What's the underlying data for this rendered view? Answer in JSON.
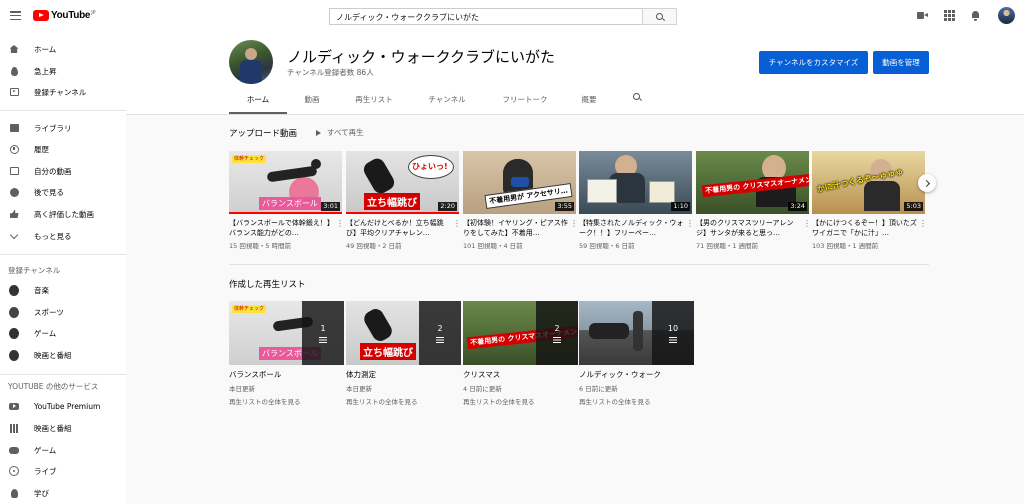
{
  "header": {
    "logo_text": "YouTube",
    "logo_region": "JP",
    "search_value": "ノルディック・ウォーククラブにいがた"
  },
  "sidebar": {
    "main": [
      {
        "label": "ホーム",
        "icon": "home-icon"
      },
      {
        "label": "急上昇",
        "icon": "fire-icon"
      },
      {
        "label": "登録チャンネル",
        "icon": "subscriptions-icon"
      }
    ],
    "library": [
      {
        "label": "ライブラリ",
        "icon": "library-icon"
      },
      {
        "label": "履歴",
        "icon": "history-icon"
      },
      {
        "label": "自分の動画",
        "icon": "your-videos-icon"
      },
      {
        "label": "後で見る",
        "icon": "watch-later-icon"
      },
      {
        "label": "高く評価した動画",
        "icon": "like-icon"
      },
      {
        "label": "もっと見る",
        "icon": "chevron-down-icon"
      }
    ],
    "subs_heading": "登録チャンネル",
    "subs": [
      {
        "label": "音楽",
        "icon": "music-icon"
      },
      {
        "label": "スポーツ",
        "icon": "sports-icon"
      },
      {
        "label": "ゲーム",
        "icon": "gaming-icon"
      },
      {
        "label": "映画と番組",
        "icon": "movies-icon"
      }
    ],
    "more_heading": "YOUTUBE の他のサービス",
    "more": [
      {
        "label": "YouTube Premium",
        "icon": "youtube-premium-icon"
      },
      {
        "label": "映画と番組",
        "icon": "film-icon"
      },
      {
        "label": "ゲーム",
        "icon": "gaming-icon"
      },
      {
        "label": "ライブ",
        "icon": "live-icon"
      },
      {
        "label": "学び",
        "icon": "learning-icon"
      }
    ]
  },
  "channel": {
    "name": "ノルディック・ウォーククラブにいがた",
    "subscribers": "チャンネル登録者数 86人",
    "customize_label": "チャンネルをカスタマイズ",
    "manage_label": "動画を管理"
  },
  "tabs": [
    "ホーム",
    "動画",
    "再生リスト",
    "チャンネル",
    "フリートーク",
    "概要"
  ],
  "uploads": {
    "title": "アップロード動画",
    "play_all": "すべて再生",
    "videos": [
      {
        "title": "【バランスボールで体幹鍛え！】バランス能力がどの…",
        "meta": "15 回視聴・5 時間前",
        "duration": "3:01",
        "caption": "バランスボール",
        "badge": "体幹チェック",
        "progress": 1.0
      },
      {
        "title": "【どんだけとべるか！立ち幅跳び】平均クリアチャレン…",
        "meta": "49 回視聴・2 日前",
        "duration": "2:20",
        "caption": "立ち幅跳び",
        "bubble": "ひょいっ!",
        "progress": 1.0
      },
      {
        "title": "【初体験！イヤリング・ピアス作りをしてみた】不着用…",
        "meta": "101 回視聴・4 日前",
        "duration": "3:55",
        "caption": "不着用男が アクセサリ…",
        "progress": 0.0
      },
      {
        "title": "【特集されたノルディック・ウォーク！！】フリーペー…",
        "meta": "59 回視聴・6 日前",
        "duration": "1:10",
        "progress": 0.0
      },
      {
        "title": "【男のクリスマスツリーアレンジ】サンタが来ると思っ…",
        "meta": "71 回視聴・1 週間前",
        "duration": "3:24",
        "caption": "不着用男の クリスマスオーナメント",
        "progress": 0.0
      },
      {
        "title": "【かにけつくるぞー！】頂いたズワイガニで「かに汁」…",
        "meta": "103 回視聴・1 週間前",
        "duration": "5:03",
        "caption": "かに汁つくるぞ〜ゅゅゅ",
        "progress": 0.0
      }
    ]
  },
  "playlists": {
    "title": "作成した再生リスト",
    "items": [
      {
        "title": "バランスボール",
        "updated": "本日更新",
        "count": "1",
        "view_all": "再生リストの全体を見る",
        "caption": "バランスボール",
        "badge": "体幹チェック"
      },
      {
        "title": "体力測定",
        "updated": "本日更新",
        "count": "2",
        "view_all": "再生リストの全体を見る",
        "caption": "立ち幅跳び"
      },
      {
        "title": "クリスマス",
        "updated": "4 日前に更新",
        "count": "2",
        "view_all": "再生リストの全体を見る",
        "caption": "不着用男の クリスマスオーナメント"
      },
      {
        "title": "ノルディック・ウォーク",
        "updated": "6 日前に更新",
        "count": "10",
        "view_all": "再生リストの全体を見る"
      }
    ]
  },
  "colors": {
    "brand_red": "#ff0000",
    "accent_blue": "#065fd4",
    "progress_red": "#ff0000"
  }
}
